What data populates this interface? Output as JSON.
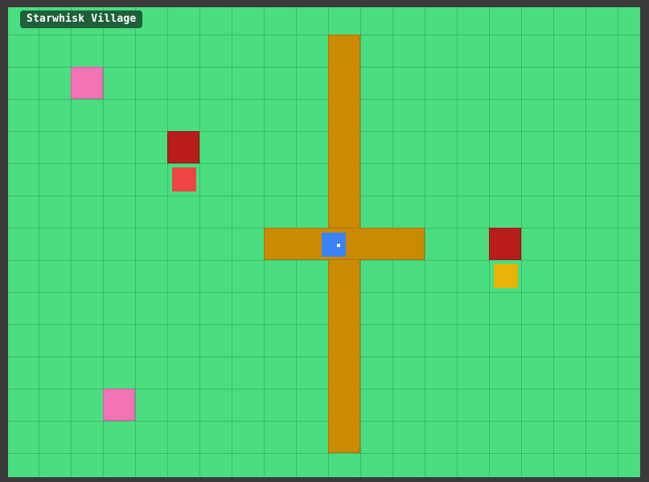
{
  "location": {
    "name": "Starwhisk Village"
  },
  "colors": {
    "grass": "#4ade80",
    "path": "#ca8a04",
    "flower": "#f472b6",
    "house": "#b91c1c",
    "npc_red": "#ef4444",
    "npc_yellow": "#eab308",
    "player": "#3b82f6",
    "frame": "#3a3a3a"
  },
  "entities": {
    "player": {
      "icon": "player-sprite",
      "color": "#3b82f6"
    },
    "npcs": [
      {
        "icon": "villager-sprite",
        "color": "#ef4444"
      },
      {
        "icon": "villager-sprite",
        "color": "#eab308"
      }
    ]
  }
}
